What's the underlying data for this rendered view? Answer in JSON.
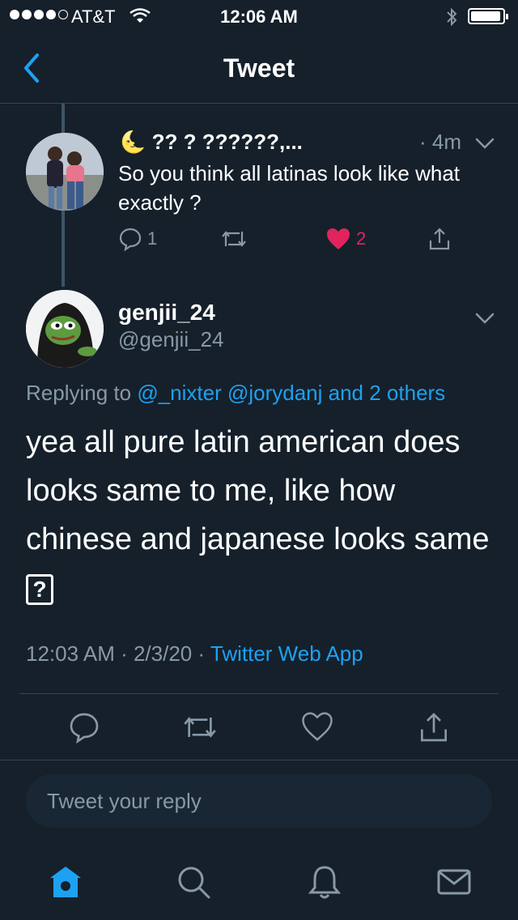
{
  "status_bar": {
    "carrier": "AT&T",
    "time": "12:06 AM"
  },
  "nav": {
    "title": "Tweet"
  },
  "parent_tweet": {
    "moon": "🌜",
    "display_name": "?? ? ??????,...",
    "time": "· 4m",
    "text": "So you think all latinas look like what exactly ?",
    "reply_count": "1",
    "like_count": "2"
  },
  "main_tweet": {
    "display_name": "genjii_24",
    "handle": "@genjii_24",
    "replying_prefix": "Replying to ",
    "replying_links": "@_nixter @jorydanj and 2 others",
    "text": "yea all  pure latin american does looks same to me, like  how chinese and japanese looks same ",
    "emoji_box": "?",
    "timestamp": "12:03 AM · 2/3/20 · ",
    "app": "Twitter Web App"
  },
  "reply": {
    "placeholder": "Tweet your reply"
  },
  "colors": {
    "background": "#15202b",
    "accent": "#1da1f2",
    "secondary_text": "#8899a6",
    "like": "#e0245e"
  },
  "icons": {
    "back": "chevron-left-icon",
    "reply": "comment-icon",
    "retweet": "retweet-icon",
    "like": "heart-icon",
    "share": "share-icon",
    "home": "home-icon",
    "search": "search-icon",
    "notifications": "bell-icon",
    "messages": "mail-icon"
  }
}
